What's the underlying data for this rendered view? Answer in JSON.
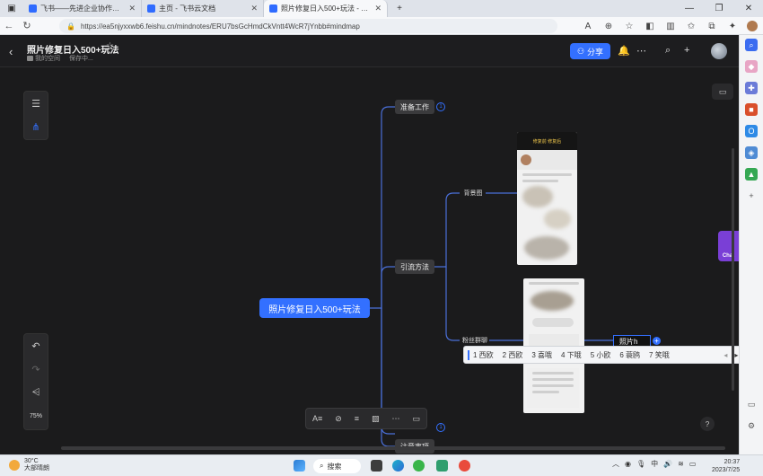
{
  "browser": {
    "tabs": [
      {
        "title": "飞书——先进企业协作与管理平台",
        "active": false,
        "color": "#2f6bff"
      },
      {
        "title": "主页 - 飞书云文档",
        "active": false,
        "color": "#2f6bff"
      },
      {
        "title": "照片修复日入500+玩法 - 飞书云...",
        "active": true,
        "color": "#2f6bff"
      }
    ],
    "url": "https://ea5njyxxwb6.feishu.cn/mindnotes/ERU7bsGcHmdCkVntt4WcR7jYnbb#mindmap"
  },
  "header": {
    "title": "照片修复日入500+玩法",
    "breadcrumb_space": "我的空间",
    "status": "保存中...",
    "share_label": "分享"
  },
  "mindmap": {
    "root": "照片修复日入500+玩法",
    "nodes": {
      "prep": "准备工作",
      "traffic": "引流方法",
      "background": "背景图",
      "fans": "粉丝群聊",
      "editing": "照片h",
      "bottom_partial": "注意事项"
    },
    "badges": {
      "prep": "1",
      "bottom": "1"
    },
    "thumb_caption": "修复前  修复后"
  },
  "ime": {
    "candidates": [
      "1 西欧",
      "2 西欧",
      "3 喜哦",
      "4 下哦",
      "5 小欧",
      "6 蓑鸥",
      "7 笑哦"
    ]
  },
  "zoom": "75%",
  "chat_ext_label": "Chat",
  "taskbar": {
    "weather_temp": "30°C",
    "weather_desc": "大部晴朗",
    "search": "搜索",
    "tray_lang": "中",
    "time": "20:37",
    "date": "2023/7/25"
  },
  "colors": {
    "accent": "#3370ff",
    "canvas": "#1b1b1c",
    "node": "#3a3a3c"
  }
}
